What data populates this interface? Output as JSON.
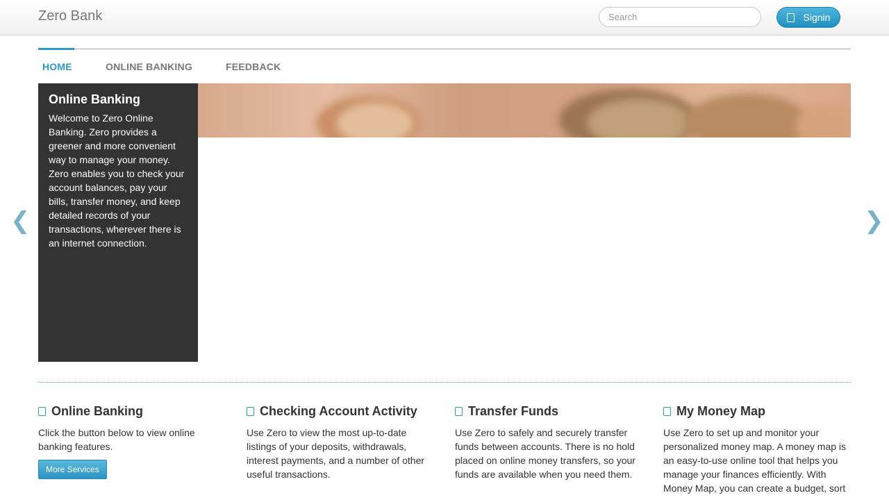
{
  "navbar": {
    "brand": "Zero Bank",
    "search_placeholder": "Search",
    "signin_label": "Signin"
  },
  "tabs": [
    {
      "label": "HOME",
      "active": true
    },
    {
      "label": "ONLINE BANKING",
      "active": false
    },
    {
      "label": "FEEDBACK",
      "active": false
    }
  ],
  "hero": {
    "title": "Online Banking",
    "text": "Welcome to Zero Online Banking. Zero provides a greener and more convenient way to manage your money. Zero enables you to check your account balances, pay your bills, transfer money, and keep detailed records of your transactions, wherever there is an internet connection.",
    "prev_arrow": "❮",
    "next_arrow": "❯"
  },
  "features": [
    {
      "title": "Online Banking",
      "text": "Click the button below to view online banking features.",
      "button": "More Services"
    },
    {
      "title": "Checking Account Activity",
      "text": "Use Zero to view the most up-to-date listings of your deposits, withdrawals, interest payments, and a number of other useful transactions."
    },
    {
      "title": "Transfer Funds",
      "text": "Use Zero to safely and securely transfer funds between accounts. There is no hold placed on online money transfers, so your funds are available when you need them."
    },
    {
      "title": "My Money Map",
      "text": "Use Zero to set up and monitor your personalized money map. A money map is an easy-to-use online tool that helps you manage your finances efficiently. With Money Map, you can create a budget, sort"
    }
  ],
  "colors": {
    "accent": "#2c98c8",
    "hero_panel": "#333333"
  }
}
